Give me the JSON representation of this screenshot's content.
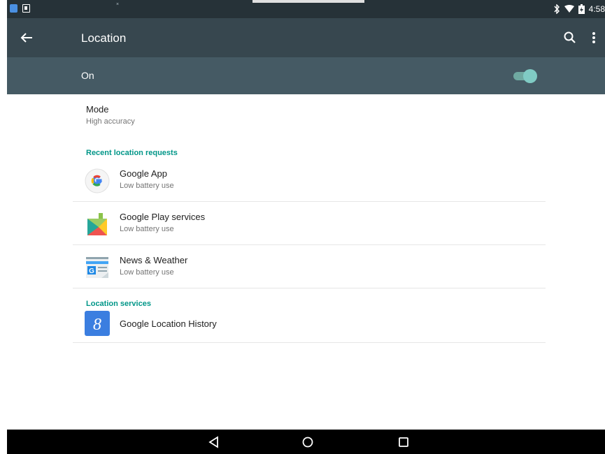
{
  "status_bar": {
    "time": "4:58"
  },
  "app_bar": {
    "title": "Location"
  },
  "master_switch": {
    "label": "On",
    "enabled": true,
    "accent_color": "#80cbc4"
  },
  "mode": {
    "title": "Mode",
    "value": "High accuracy"
  },
  "recent_requests": {
    "header": "Recent location requests",
    "items": [
      {
        "title": "Google App",
        "subtitle": "Low battery use",
        "icon": "google-app-icon"
      },
      {
        "title": "Google Play services",
        "subtitle": "Low battery use",
        "icon": "google-play-services-icon"
      },
      {
        "title": "News & Weather",
        "subtitle": "Low battery use",
        "icon": "news-weather-icon"
      }
    ]
  },
  "location_services": {
    "header": "Location services",
    "items": [
      {
        "title": "Google Location History",
        "icon": "google-location-history-icon"
      }
    ]
  },
  "colors": {
    "status_bar": "#263238",
    "app_bar": "#37474f",
    "switch_bar": "#455a64",
    "section_header": "#009688"
  }
}
